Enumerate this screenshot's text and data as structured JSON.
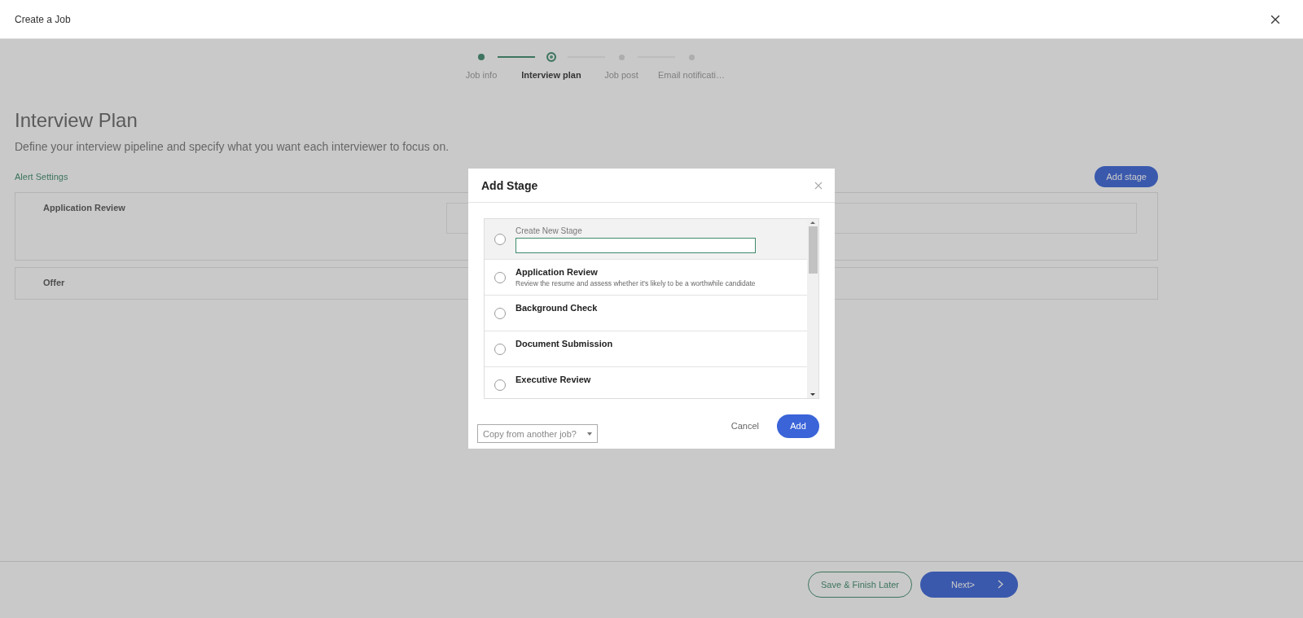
{
  "window": {
    "title": "Create a Job"
  },
  "stepper": [
    {
      "label": "Job info",
      "completed": true,
      "selected": false
    },
    {
      "label": "Interview plan",
      "completed": false,
      "selected": true
    },
    {
      "label": "Job post",
      "completed": false,
      "selected": false
    },
    {
      "label": "Email notificati…",
      "completed": false,
      "selected": false
    }
  ],
  "page": {
    "heading": "Interview Plan",
    "subtitle": "Define your interview pipeline and specify what you want each interviewer to focus on.",
    "alert_link": "Alert Settings",
    "add_button": "Add stage",
    "stages": [
      {
        "name": "Application Review",
        "kind": "expanded"
      },
      {
        "name": "Offer",
        "kind": "collapsed"
      }
    ]
  },
  "footer": {
    "save": "Save & Finish Later",
    "next": "Next>"
  },
  "dialog": {
    "title": "Add Stage",
    "options": [
      {
        "kind": "create",
        "label": "Create New Stage",
        "selected": false
      },
      {
        "kind": "stage",
        "name": "Application Review",
        "description": "Review the resume and assess whether it's likely to be a worthwhile candidate",
        "selected": false
      },
      {
        "kind": "stage",
        "name": "Background Check",
        "selected": false
      },
      {
        "kind": "stage",
        "name": "Document Submission",
        "selected": false
      },
      {
        "kind": "stage",
        "name": "Executive Review",
        "selected": false
      }
    ],
    "copy_placeholder": "Copy from another job?",
    "cancel": "Cancel",
    "add": "Add"
  }
}
